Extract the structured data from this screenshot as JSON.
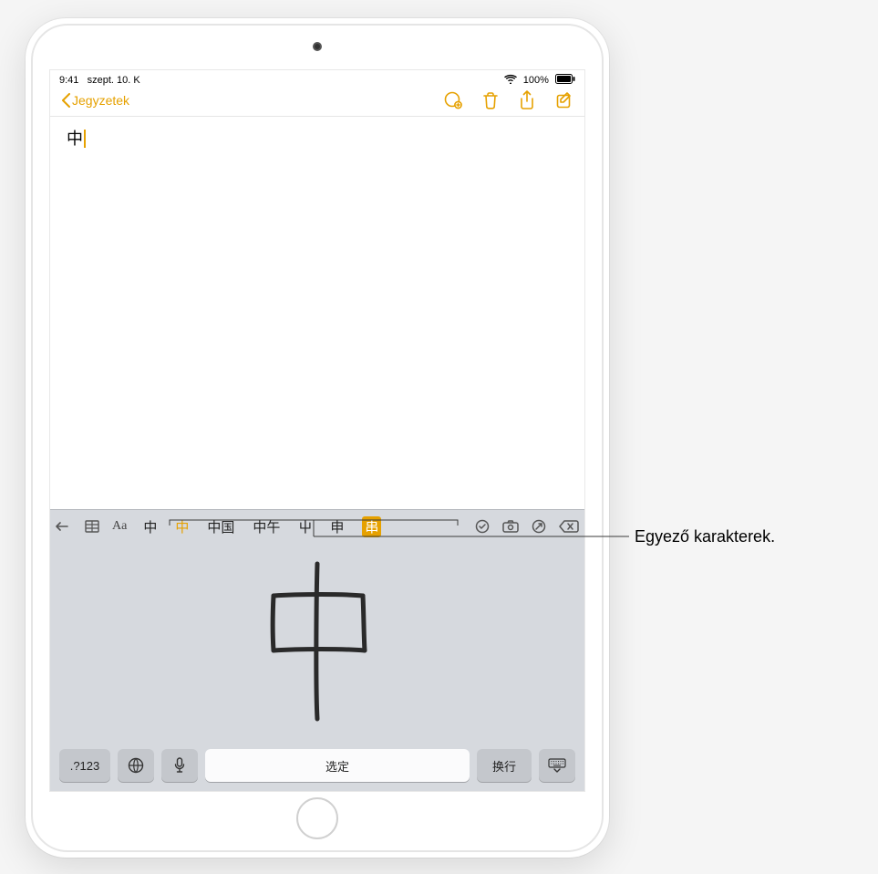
{
  "status": {
    "time": "9:41",
    "date": "szept. 10. K",
    "battery_pct": "100%"
  },
  "nav": {
    "back_label": "Jegyzetek"
  },
  "note": {
    "content": "中"
  },
  "candidates": {
    "items": [
      {
        "text": "中",
        "style": "plain"
      },
      {
        "text": "中",
        "style": "sel"
      },
      {
        "text": "中国",
        "style": "plain"
      },
      {
        "text": "中午",
        "style": "plain"
      },
      {
        "text": "屮",
        "style": "plain"
      },
      {
        "text": "申",
        "style": "plain"
      },
      {
        "text": "串",
        "style": "hl"
      }
    ]
  },
  "keys": {
    "num_label": ".?123",
    "space_label": "选定",
    "return_label": "换行"
  },
  "callout": {
    "text": "Egyező karakterek."
  }
}
